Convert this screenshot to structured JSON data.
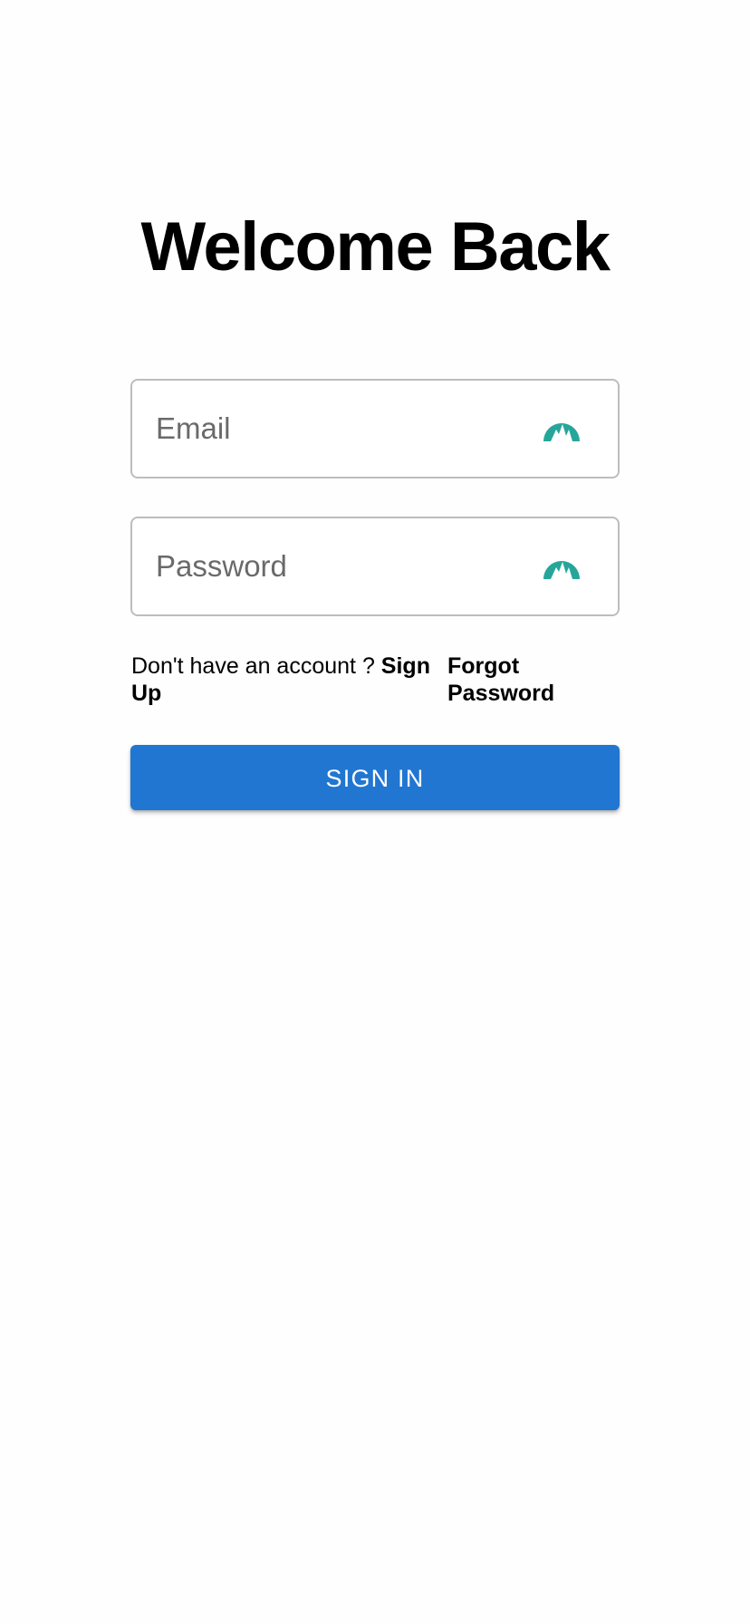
{
  "page": {
    "title": "Welcome Back"
  },
  "form": {
    "email": {
      "placeholder": "Email",
      "value": "",
      "icon": "password-manager-icon"
    },
    "password": {
      "placeholder": "Password",
      "value": "",
      "icon": "password-manager-icon"
    },
    "signup_prompt": "Don't have an account ? ",
    "signup_link": "Sign Up",
    "forgot_link": "Forgot Password",
    "submit_label": "SIGN IN"
  },
  "colors": {
    "accent": "#2176d2",
    "icon": "#26a69a",
    "field_border": "#bdbdbd"
  }
}
